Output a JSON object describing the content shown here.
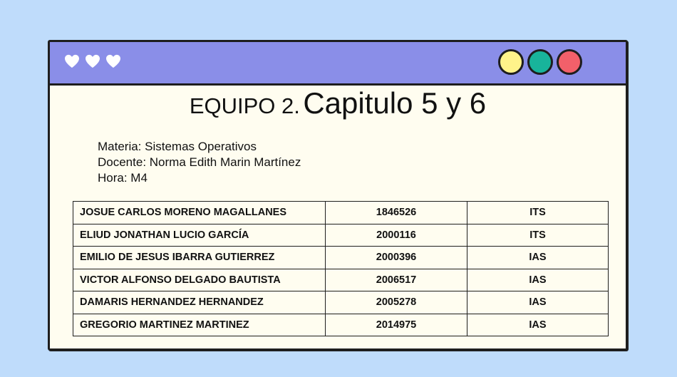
{
  "window": {
    "titlebar": {
      "hearts": [
        "heart-icon",
        "heart-icon",
        "heart-icon"
      ],
      "buttons": [
        {
          "name": "yellow-circle-button",
          "color": "#fff38a"
        },
        {
          "name": "teal-circle-button",
          "color": "#18b49b"
        },
        {
          "name": "red-circle-button",
          "color": "#f2606a"
        }
      ],
      "color": "#8a8ee8"
    },
    "title": {
      "prefix": "EQUIPO 2.",
      "main": "Capitulo 5 y 6"
    },
    "info": {
      "materia": "Materia: Sistemas Operativos",
      "docente": "Docente: Norma Edith Marin Martínez",
      "hora": "Hora: M4"
    },
    "table": {
      "rows": [
        {
          "name": "JOSUE CARLOS MORENO MAGALLANES",
          "id": "1846526",
          "career": "ITS"
        },
        {
          "name": "ELIUD JONATHAN LUCIO GARCÍA",
          "id": "2000116",
          "career": "ITS"
        },
        {
          "name": "EMILIO DE JESUS IBARRA GUTIERREZ",
          "id": "2000396",
          "career": "IAS"
        },
        {
          "name": "VICTOR ALFONSO DELGADO BAUTISTA",
          "id": "2006517",
          "career": "IAS"
        },
        {
          "name": "DAMARIS HERNANDEZ HERNANDEZ",
          "id": "2005278",
          "career": "IAS"
        },
        {
          "name": "GREGORIO MARTINEZ MARTINEZ",
          "id": "2014975",
          "career": "IAS"
        }
      ]
    }
  },
  "colors": {
    "background": "#bfdcfb",
    "window": "#fffdf0"
  }
}
